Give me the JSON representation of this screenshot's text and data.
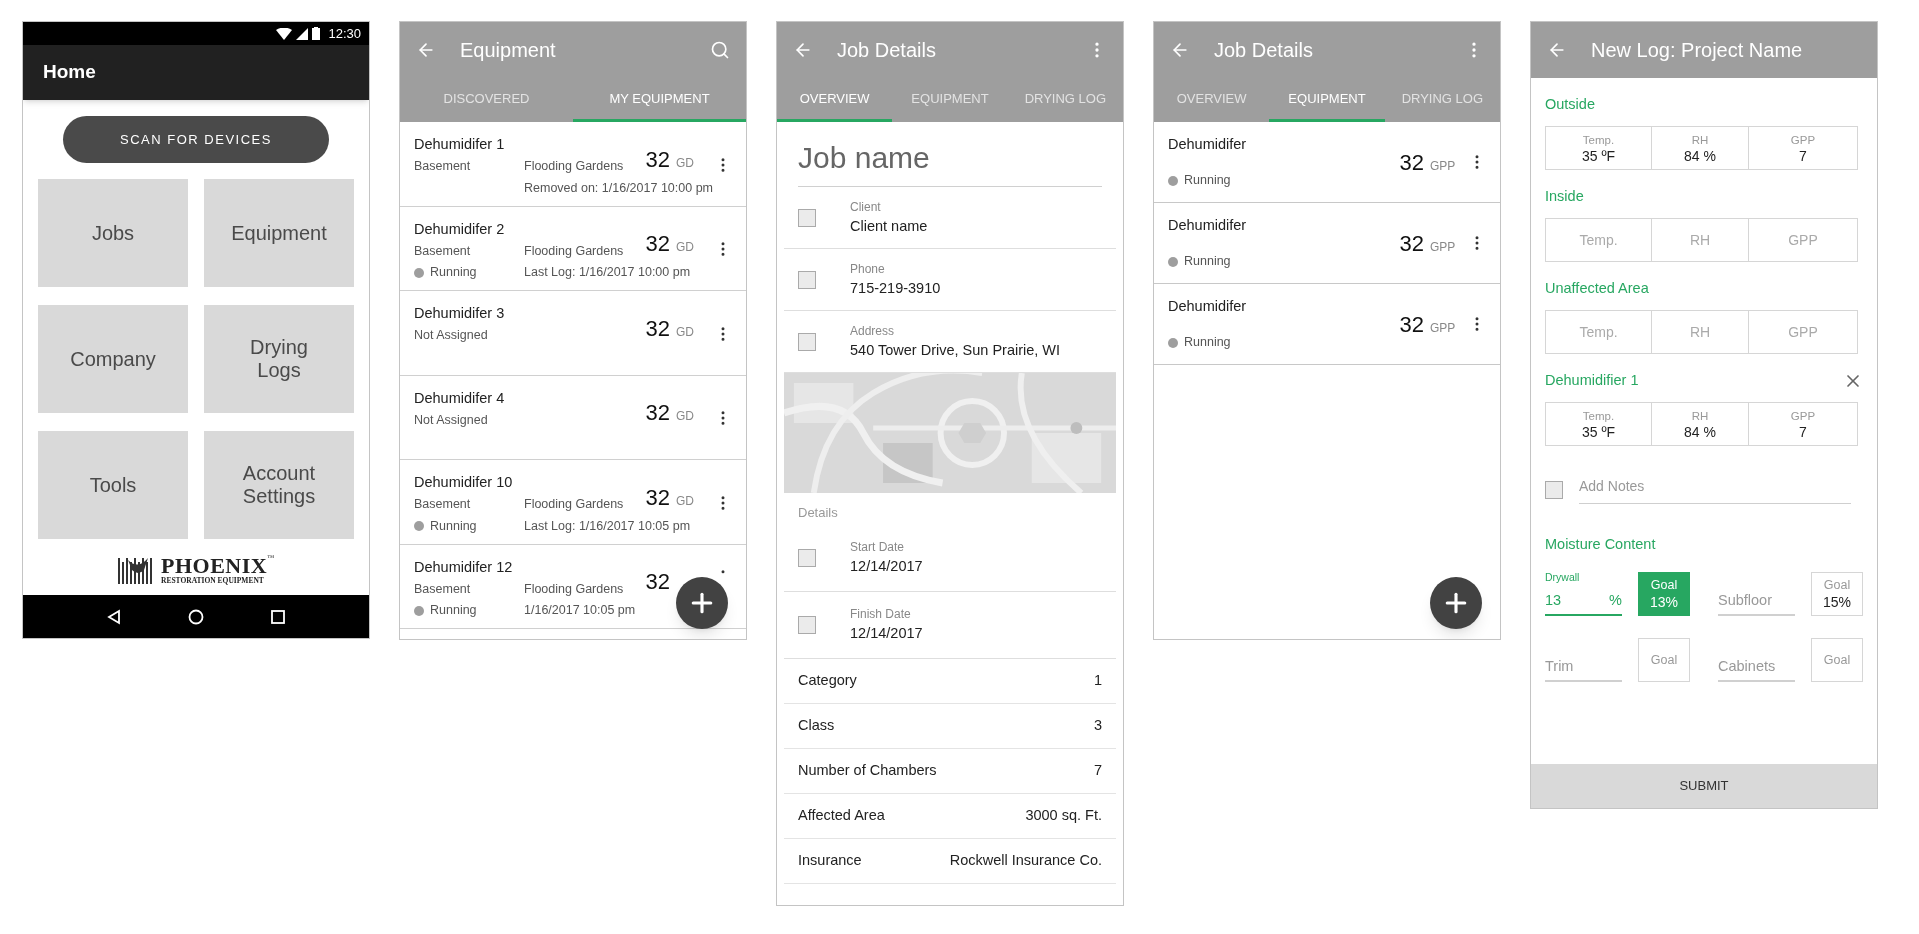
{
  "home": {
    "status_time": "12:30",
    "title": "Home",
    "scan_button": "SCAN FOR DEVICES",
    "tiles": [
      "Jobs",
      "Company",
      "Tools",
      "Equipment",
      "Drying Logs",
      "Account Settings"
    ],
    "logo": {
      "name": "PHOENIX",
      "mark": "™",
      "tagline": "RESTORATION EQUIPMENT"
    }
  },
  "equipment": {
    "title": "Equipment",
    "tabs": [
      {
        "label": "DISCOVERED",
        "selected": false
      },
      {
        "label": "MY EQUIPMENT",
        "selected": true
      }
    ],
    "items": [
      {
        "name": "Dehumidifer 1",
        "location": "Basement",
        "job": "Flooding Gardens",
        "reading": "32",
        "unit": "GD",
        "note": "Removed on: 1/16/2017 10:00 pm"
      },
      {
        "name": "Dehumidifer 2",
        "location": "Basement",
        "job": "Flooding Gardens",
        "reading": "32",
        "unit": "GD",
        "status": "Running",
        "note": "Last Log: 1/16/2017 10:00 pm"
      },
      {
        "name": "Dehumidifer 3",
        "location": "Not Assigned",
        "reading": "32",
        "unit": "GD"
      },
      {
        "name": "Dehumidifer 4",
        "location": "Not Assigned",
        "reading": "32",
        "unit": "GD"
      },
      {
        "name": "Dehumidifer 10",
        "location": "Basement",
        "job": "Flooding Gardens",
        "reading": "32",
        "unit": "GD",
        "status": "Running",
        "note": "Last Log: 1/16/2017 10:05 pm"
      },
      {
        "name": "Dehumidifer 12",
        "location": "Basement",
        "job": "Flooding Gardens",
        "reading": "32",
        "status": "Running",
        "note": "1/16/2017 10:05 pm"
      }
    ]
  },
  "job_overview": {
    "title": "Job Details",
    "tabs": [
      {
        "label": "OVERVIEW",
        "selected": true
      },
      {
        "label": "EQUIPMENT",
        "selected": false
      },
      {
        "label": "DRYING LOG",
        "selected": false
      }
    ],
    "job_name": {
      "placeholder": "Job name"
    },
    "contact_fields": [
      {
        "label": "Client",
        "value": "Client name"
      },
      {
        "label": "Phone",
        "value": "715-219-3910"
      },
      {
        "label": "Address",
        "value": "540 Tower Drive, Sun Prairie, WI"
      }
    ],
    "details_heading": "Details",
    "date_fields": [
      {
        "label": "Start Date",
        "value": "12/14/2017"
      },
      {
        "label": "Finish Date",
        "value": "12/14/2017"
      }
    ],
    "properties": [
      {
        "label": "Category",
        "value": "1"
      },
      {
        "label": "Class",
        "value": "3"
      },
      {
        "label": "Number of Chambers",
        "value": "7"
      },
      {
        "label": "Affected Area",
        "value": "3000 sq. Ft."
      },
      {
        "label": "Insurance",
        "value": "Rockwell Insurance Co."
      }
    ]
  },
  "job_equipment": {
    "title": "Job Details",
    "tabs": [
      {
        "label": "OVERVIEW",
        "selected": false
      },
      {
        "label": "EQUIPMENT",
        "selected": true
      },
      {
        "label": "DRYING LOG",
        "selected": false
      }
    ],
    "items": [
      {
        "name": "Dehumidifer",
        "reading": "32",
        "unit": "GPP",
        "status": "Running"
      },
      {
        "name": "Dehumidifer",
        "reading": "32",
        "unit": "GPP",
        "status": "Running"
      },
      {
        "name": "Dehumidifer",
        "reading": "32",
        "unit": "GPP",
        "status": "Running"
      }
    ]
  },
  "new_log": {
    "title": "New Log: Project Name",
    "sections": [
      {
        "title": "Outside",
        "kind": "area",
        "readings": [
          {
            "label": "Temp.",
            "value": "35 ºF"
          },
          {
            "label": "RH",
            "value": "84 %"
          },
          {
            "label": "GPP",
            "value": "7"
          }
        ]
      },
      {
        "title": "Inside",
        "kind": "area",
        "readings": [
          {
            "label": "Temp."
          },
          {
            "label": "RH"
          },
          {
            "label": "GPP"
          }
        ]
      },
      {
        "title": "Unaffected Area",
        "kind": "area",
        "readings": [
          {
            "label": "Temp."
          },
          {
            "label": "RH"
          },
          {
            "label": "GPP"
          }
        ]
      },
      {
        "title": "Dehumidifier 1",
        "kind": "equipment",
        "readings": [
          {
            "label": "Temp.",
            "value": "35 ºF"
          },
          {
            "label": "RH",
            "value": "84 %"
          },
          {
            "label": "GPP",
            "value": "7"
          }
        ]
      }
    ],
    "notes": {
      "placeholder": "Add Notes"
    },
    "moisture_heading": "Moisture Content",
    "materials": [
      {
        "label": "Drywall",
        "value": "13",
        "unit": "%",
        "goal_label": "Goal",
        "goal": "13%",
        "focused": true
      },
      {
        "label": "Subfloor",
        "goal_label": "Goal",
        "goal": "15%",
        "focused": false
      },
      {
        "label": "Trim",
        "goal_label": "Goal",
        "focused": false
      },
      {
        "label": "Cabinets",
        "goal_label": "Goal",
        "focused": false
      }
    ],
    "submit_button": "SUBMIT"
  }
}
